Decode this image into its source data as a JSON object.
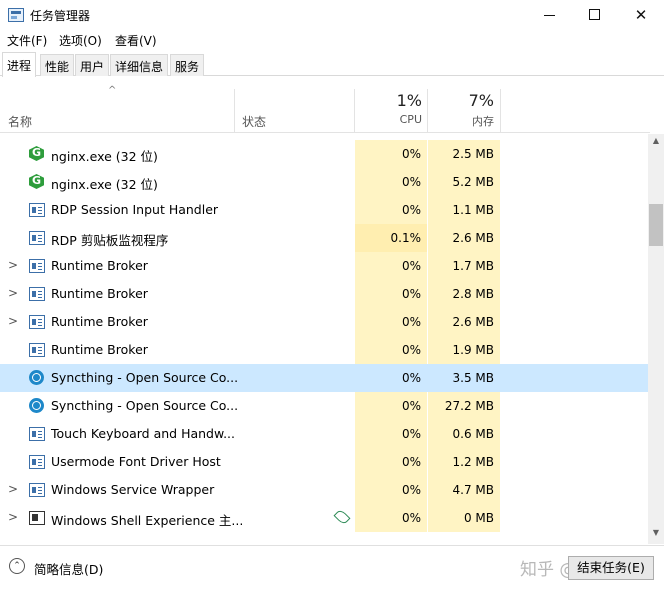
{
  "window": {
    "title": "任务管理器",
    "minimize": "–",
    "maximize": "□",
    "close": "✕"
  },
  "menu": [
    "文件(F)",
    "选项(O)",
    "查看(V)"
  ],
  "tabs": [
    "进程",
    "性能",
    "用户",
    "详细信息",
    "服务"
  ],
  "header": {
    "sort_indicator": "^",
    "name": "名称",
    "status": "状态",
    "cpu_percent": "1%",
    "cpu": "CPU",
    "mem_percent": "7%",
    "mem": "内存"
  },
  "rows": [
    {
      "name": "nginx.exe (32 位)",
      "cpu": "0%",
      "mem": "2.5 MB",
      "icon": "nginx-icon",
      "expand": ""
    },
    {
      "name": "nginx.exe (32 位)",
      "cpu": "0%",
      "mem": "5.2 MB",
      "icon": "nginx-icon",
      "expand": ""
    },
    {
      "name": "RDP Session Input Handler",
      "cpu": "0%",
      "mem": "1.1 MB",
      "icon": "app-icon",
      "expand": ""
    },
    {
      "name": "RDP 剪贴板监视程序",
      "cpu": "0.1%",
      "mem": "2.6 MB",
      "icon": "app-icon",
      "expand": ""
    },
    {
      "name": "Runtime Broker",
      "cpu": "0%",
      "mem": "1.7 MB",
      "icon": "app-icon",
      "expand": ">"
    },
    {
      "name": "Runtime Broker",
      "cpu": "0%",
      "mem": "2.8 MB",
      "icon": "app-icon",
      "expand": ">"
    },
    {
      "name": "Runtime Broker",
      "cpu": "0%",
      "mem": "2.6 MB",
      "icon": "app-icon",
      "expand": ">"
    },
    {
      "name": "Runtime Broker",
      "cpu": "0%",
      "mem": "1.9 MB",
      "icon": "app-icon",
      "expand": ""
    },
    {
      "name": "Syncthing - Open Source Co...",
      "cpu": "0%",
      "mem": "3.5 MB",
      "icon": "syncthing-icon",
      "expand": ""
    },
    {
      "name": "Syncthing - Open Source Co...",
      "cpu": "0%",
      "mem": "27.2 MB",
      "icon": "syncthing-icon",
      "expand": ""
    },
    {
      "name": "Touch Keyboard and Handw...",
      "cpu": "0%",
      "mem": "0.6 MB",
      "icon": "app-icon",
      "expand": ""
    },
    {
      "name": "Usermode Font Driver Host",
      "cpu": "0%",
      "mem": "1.2 MB",
      "icon": "app-icon",
      "expand": ""
    },
    {
      "name": "Windows Service Wrapper",
      "cpu": "0%",
      "mem": "4.7 MB",
      "icon": "app-icon",
      "expand": ">"
    },
    {
      "name": "Windows Shell Experience 主...",
      "cpu": "0%",
      "mem": "0 MB",
      "icon": "shell-icon",
      "expand": ">"
    }
  ],
  "footer": {
    "fewer_details": "简略信息(D)",
    "end_task": "结束任务(E)",
    "watermark": "知乎 @工程师"
  },
  "colors": {
    "cpu_mem_bg": "#fff4c4",
    "selected_row": "#cce8ff",
    "accent": "#1e88c9"
  }
}
